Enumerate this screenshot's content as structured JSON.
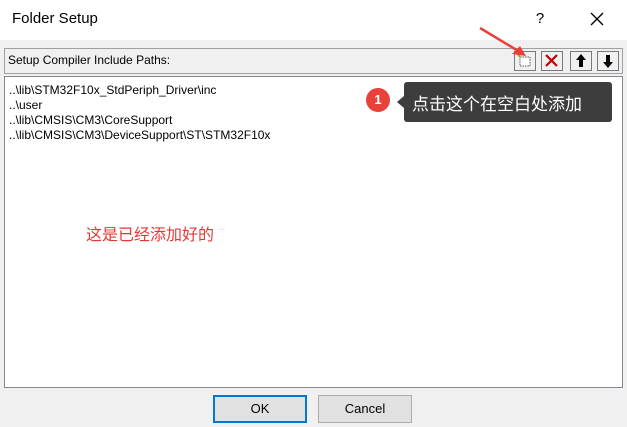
{
  "window": {
    "title": "Folder Setup",
    "help_label": "?"
  },
  "header": {
    "label": "Setup Compiler Include Paths:"
  },
  "paths": [
    "..\\lib\\STM32F10x_StdPeriph_Driver\\inc",
    "..\\user",
    "..\\lib\\CMSIS\\CM3\\CoreSupport",
    "..\\lib\\CMSIS\\CM3\\DeviceSupport\\ST\\STM32F10x"
  ],
  "toolbar": {
    "icons": [
      "new-folder-icon",
      "delete-icon",
      "move-up-icon",
      "move-down-icon"
    ]
  },
  "annotation": {
    "badge": "1",
    "tooltip": "点击这个在空白处添加",
    "note": "这是已经添加好的",
    "colors": {
      "badge": "#e8413a",
      "note": "#e53935",
      "tooltip_bg": "#3d3d3d",
      "arrow": "#e8413a"
    }
  },
  "buttons": {
    "ok": "OK",
    "cancel": "Cancel"
  }
}
